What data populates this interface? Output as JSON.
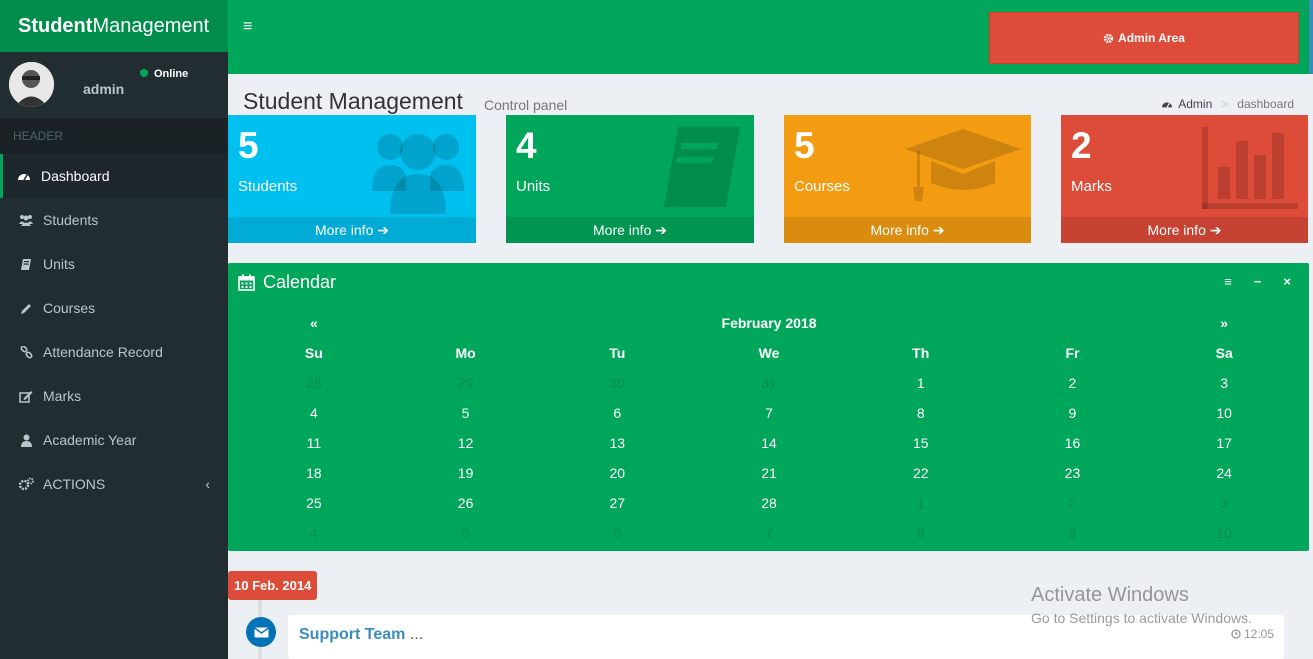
{
  "app": {
    "logo_bold": "Student",
    "logo_rest": "Management"
  },
  "user": {
    "name": "admin",
    "status": "Online"
  },
  "sidebar": {
    "header": "HEADER",
    "items": [
      {
        "label": "Dashboard",
        "icon": "dashboard-icon"
      },
      {
        "label": "Students",
        "icon": "users-icon"
      },
      {
        "label": "Units",
        "icon": "book-icon"
      },
      {
        "label": "Courses",
        "icon": "pencil-icon"
      },
      {
        "label": "Attendance Record",
        "icon": "link-icon"
      },
      {
        "label": "Marks",
        "icon": "edit-icon"
      },
      {
        "label": "Academic Year",
        "icon": "user-icon"
      },
      {
        "label": "ACTIONS",
        "icon": "cogs-icon",
        "chevron": "‹"
      }
    ]
  },
  "topbar": {
    "hamburger": "≡",
    "admin_area": "Admin Area"
  },
  "content_header": {
    "title": "Student Management",
    "subtitle": "Control panel",
    "breadcrumb_root": "Admin",
    "breadcrumb_sep": ">",
    "breadcrumb_current": "dashboard"
  },
  "stats": [
    {
      "value": "5",
      "label": "Students",
      "more": "More info",
      "color": "#00c0ef"
    },
    {
      "value": "4",
      "label": "Units",
      "more": "More info",
      "color": "#00a65a"
    },
    {
      "value": "5",
      "label": "Courses",
      "more": "More info",
      "color": "#f39c12"
    },
    {
      "value": "2",
      "label": "Marks",
      "more": "More info",
      "color": "#dd4b39"
    }
  ],
  "calendar": {
    "title": "Calendar",
    "month": "February 2018",
    "prev": "«",
    "next": "»",
    "tools": [
      "≡",
      "−",
      "×"
    ],
    "weekdays": [
      "Su",
      "Mo",
      "Tu",
      "We",
      "Th",
      "Fr",
      "Sa"
    ],
    "weeks": [
      [
        {
          "d": "28",
          "m": true
        },
        {
          "d": "29",
          "m": true
        },
        {
          "d": "30",
          "m": true
        },
        {
          "d": "31",
          "m": true
        },
        {
          "d": "1"
        },
        {
          "d": "2"
        },
        {
          "d": "3"
        }
      ],
      [
        {
          "d": "4"
        },
        {
          "d": "5"
        },
        {
          "d": "6"
        },
        {
          "d": "7"
        },
        {
          "d": "8"
        },
        {
          "d": "9"
        },
        {
          "d": "10"
        }
      ],
      [
        {
          "d": "11"
        },
        {
          "d": "12"
        },
        {
          "d": "13"
        },
        {
          "d": "14"
        },
        {
          "d": "15"
        },
        {
          "d": "16"
        },
        {
          "d": "17"
        }
      ],
      [
        {
          "d": "18"
        },
        {
          "d": "19"
        },
        {
          "d": "20"
        },
        {
          "d": "21"
        },
        {
          "d": "22"
        },
        {
          "d": "23"
        },
        {
          "d": "24"
        }
      ],
      [
        {
          "d": "25"
        },
        {
          "d": "26"
        },
        {
          "d": "27"
        },
        {
          "d": "28"
        },
        {
          "d": "1",
          "m": true
        },
        {
          "d": "2",
          "m": true
        },
        {
          "d": "3",
          "m": true
        }
      ],
      [
        {
          "d": "4",
          "m": true
        },
        {
          "d": "5",
          "m": true
        },
        {
          "d": "6",
          "m": true
        },
        {
          "d": "7",
          "m": true
        },
        {
          "d": "8",
          "m": true
        },
        {
          "d": "9",
          "m": true
        },
        {
          "d": "10",
          "m": true
        }
      ]
    ]
  },
  "timeline": {
    "date_label": "10 Feb. 2014",
    "item_header": "Support Team",
    "item_header_suffix": "...",
    "item_time": "12:05"
  },
  "watermark": {
    "line1": "Activate Windows",
    "line2": "Go to Settings to activate Windows."
  }
}
